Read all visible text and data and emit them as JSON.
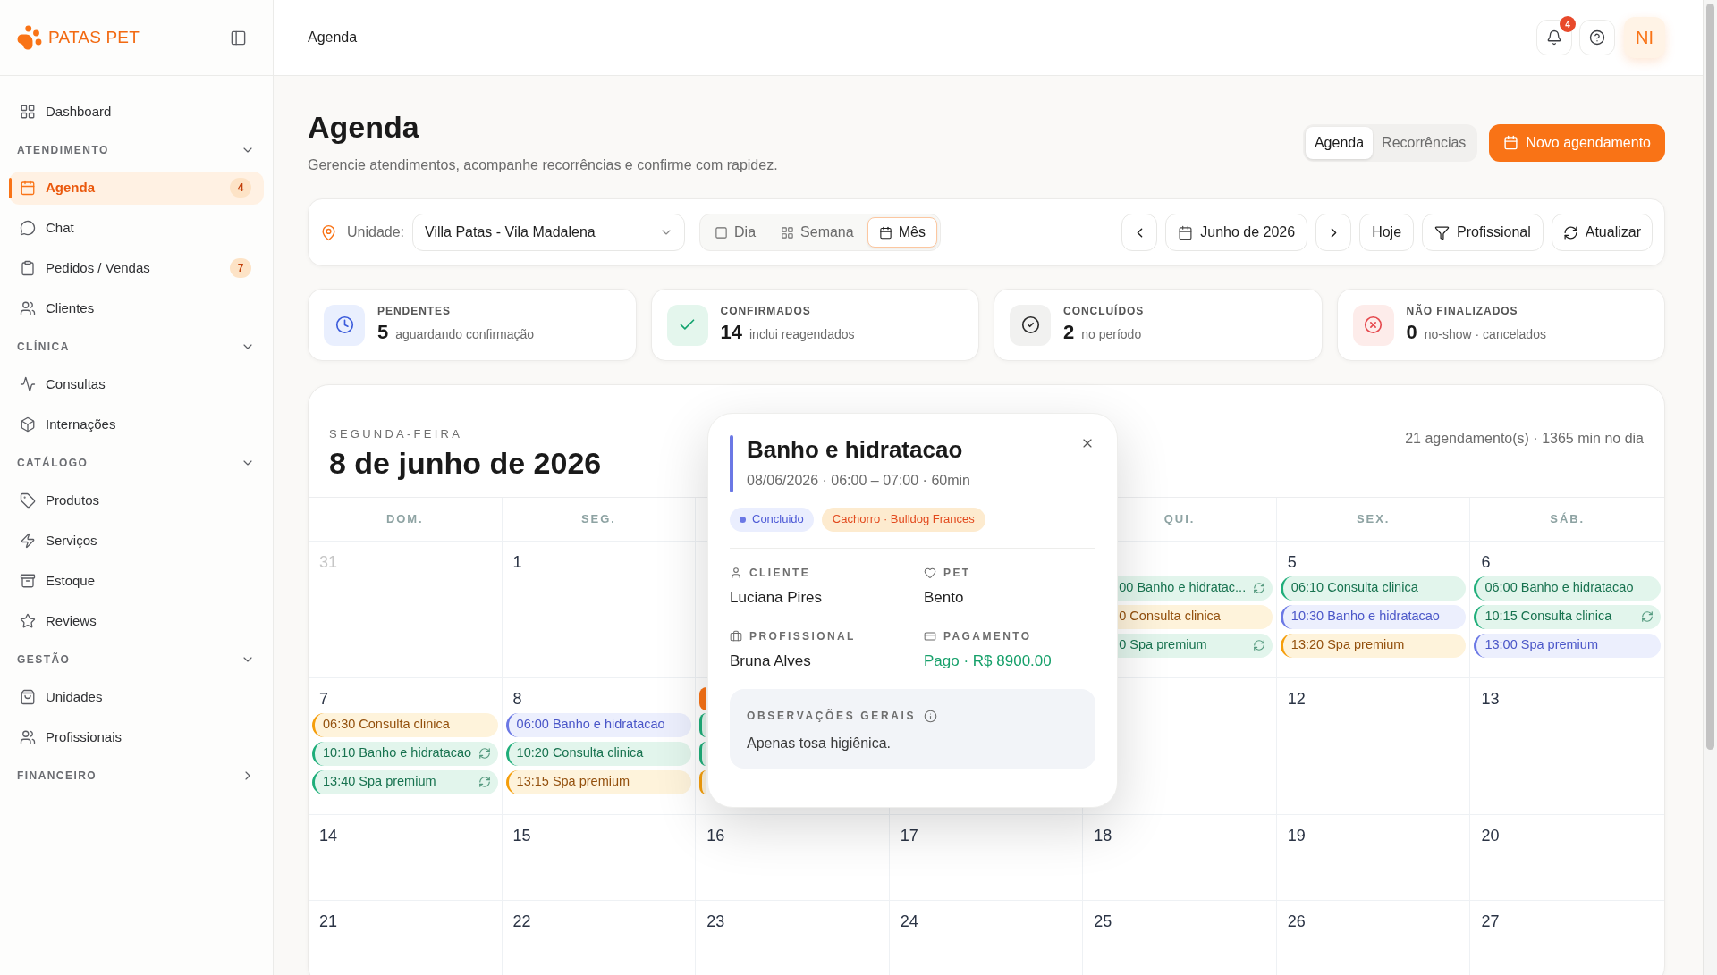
{
  "sidebar": {
    "brand": "PATAS PET",
    "top_items": [
      {
        "label": "Dashboard",
        "selected": false
      }
    ],
    "sections": [
      {
        "title": "ATENDIMENTO",
        "expanded": true,
        "items": [
          {
            "label": "Agenda",
            "selected": true,
            "badge": "4"
          },
          {
            "label": "Chat",
            "selected": false
          },
          {
            "label": "Pedidos / Vendas",
            "selected": false,
            "badge": "7"
          },
          {
            "label": "Clientes",
            "selected": false
          }
        ]
      },
      {
        "title": "CLÍNICA",
        "expanded": true,
        "items": [
          {
            "label": "Consultas",
            "selected": false
          },
          {
            "label": "Internações",
            "selected": false
          }
        ]
      },
      {
        "title": "CATÁLOGO",
        "expanded": true,
        "items": [
          {
            "label": "Produtos",
            "selected": false
          },
          {
            "label": "Serviços",
            "selected": false
          },
          {
            "label": "Estoque",
            "selected": false
          },
          {
            "label": "Reviews",
            "selected": false
          }
        ]
      },
      {
        "title": "GESTÃO",
        "expanded": true,
        "items": [
          {
            "label": "Unidades",
            "selected": false
          },
          {
            "label": "Profissionais",
            "selected": false
          }
        ]
      },
      {
        "title": "FINANCEIRO",
        "expanded": false
      }
    ]
  },
  "topbar": {
    "title": "Agenda",
    "notifications": "4",
    "avatar": "NI"
  },
  "page": {
    "title": "Agenda",
    "subtitle": "Gerencie atendimentos, acompanhe recorrências e confirme com rapidez.",
    "tabs": [
      {
        "label": "Agenda",
        "selected": true
      },
      {
        "label": "Recorrências",
        "selected": false
      }
    ],
    "primary_button": "Novo agendamento"
  },
  "toolbar": {
    "unit_label": "Unidade:",
    "unit_value": "Villa Patas - Vila Madalena",
    "views": [
      {
        "label": "Dia",
        "selected": false
      },
      {
        "label": "Semana",
        "selected": false
      },
      {
        "label": "Mês",
        "selected": true
      }
    ],
    "period": "Junho de 2026",
    "today_button": "Hoje",
    "filter_button": "Profissional",
    "refresh_button": "Atualizar"
  },
  "stats": [
    {
      "kind": "pending",
      "label": "PENDENTES",
      "value": "5",
      "note": "aguardando confirmação"
    },
    {
      "kind": "confirmed",
      "label": "CONFIRMADOS",
      "value": "14",
      "note": "inclui reagendados"
    },
    {
      "kind": "completed",
      "label": "CONCLUÍDOS",
      "value": "2",
      "note": "no período"
    },
    {
      "kind": "unfinished",
      "label": "NÃO FINALIZADOS",
      "value": "0",
      "note": "no-show · cancelados"
    }
  ],
  "calendar": {
    "weekday": "SEGUNDA-FEIRA",
    "date": "8 de junho de 2026",
    "summary": "21 agendamento(s) · 1365 min no dia",
    "weekdays": [
      {
        "kind": "label",
        "label": "DOM."
      },
      {
        "kind": "label",
        "label": "SEG."
      },
      {
        "kind": "covered"
      },
      {
        "kind": "covered"
      },
      {
        "kind": "label",
        "label": "QUI."
      },
      {
        "kind": "label",
        "label": "SEX."
      },
      {
        "kind": "label",
        "label": "SÁB."
      }
    ],
    "weeks": [
      {
        "days": [
          {
            "kind": "day",
            "day": "31",
            "muted": true
          },
          {
            "kind": "day",
            "day": "1",
            "muted": false
          },
          {
            "kind": "covered"
          },
          {
            "kind": "covered"
          },
          {
            "kind": "covered",
            "events": [
              {
                "kind": "cut",
                "text": "00 Banho e hidratac...",
                "color": "#e2f5ec",
                "recurring": true
              },
              {
                "kind": "cut",
                "text": "0 Consulta clinica",
                "color": "#fef3db",
                "recurring": false
              },
              {
                "kind": "cut",
                "text": "0 Spa premium",
                "color": "#e2f5ec",
                "recurring": true
              }
            ]
          },
          {
            "kind": "day",
            "day": "5",
            "muted": false,
            "events": [
              {
                "kind": "full",
                "text": "06:10 Consulta clinica",
                "color": "#1fae7a",
                "recurring": false
              },
              {
                "kind": "full",
                "text": "10:30 Banho e hidratacao",
                "color": "#6b78e5",
                "recurring": false
              },
              {
                "kind": "full",
                "text": "13:20 Spa premium",
                "color": "#f59e0b",
                "recurring": false
              }
            ]
          },
          {
            "kind": "day",
            "day": "6",
            "muted": false,
            "events": [
              {
                "kind": "full",
                "text": "06:00 Banho e hidratacao",
                "color": "#1fae7a",
                "recurring": false
              },
              {
                "kind": "full",
                "text": "10:15 Consulta clinica",
                "color": "#1fae7a",
                "recurring": true
              },
              {
                "kind": "full",
                "text": "13:00 Spa premium",
                "color": "#6b78e5",
                "recurring": false
              }
            ]
          }
        ]
      },
      {
        "days": [
          {
            "kind": "day",
            "day": "7",
            "muted": false,
            "events": [
              {
                "kind": "full",
                "text": "06:30 Consulta clinica",
                "color": "#f59e0b",
                "recurring": false
              },
              {
                "kind": "full",
                "text": "10:10 Banho e hidratacao",
                "color": "#1fae7a",
                "recurring": true
              },
              {
                "kind": "full",
                "text": "13:40 Spa premium",
                "color": "#1fae7a",
                "recurring": true
              }
            ]
          },
          {
            "kind": "day",
            "day": "8",
            "muted": false,
            "events": [
              {
                "kind": "full",
                "text": "06:00 Banho e hidratacao",
                "color": "#6b78e5",
                "recurring": false
              },
              {
                "kind": "full",
                "text": "10:20 Consulta clinica",
                "color": "#1fae7a",
                "recurring": false
              },
              {
                "kind": "full",
                "text": "13:15 Spa premium",
                "color": "#f59e0b",
                "recurring": false
              }
            ]
          },
          {
            "kind": "covered",
            "today": true,
            "events": [
              {
                "kind": "edge",
                "color": "#1fae7a"
              },
              {
                "kind": "edge",
                "color": "#1fae7a"
              },
              {
                "kind": "edge",
                "color": "#f59e0b"
              }
            ]
          },
          {
            "kind": "covered"
          },
          {
            "kind": "covered"
          },
          {
            "kind": "day",
            "day": "12",
            "muted": false
          },
          {
            "kind": "day",
            "day": "13",
            "muted": false
          }
        ]
      },
      {
        "days": [
          {
            "kind": "day",
            "day": "14",
            "muted": false
          },
          {
            "kind": "day",
            "day": "15",
            "muted": false
          },
          {
            "kind": "day",
            "day": "16",
            "muted": false
          },
          {
            "kind": "day",
            "day": "17",
            "muted": false
          },
          {
            "kind": "day",
            "day": "18",
            "muted": false
          },
          {
            "kind": "day",
            "day": "19",
            "muted": false
          },
          {
            "kind": "day",
            "day": "20",
            "muted": false
          }
        ]
      },
      {
        "days": [
          {
            "kind": "day",
            "day": "21",
            "muted": false
          },
          {
            "kind": "day",
            "day": "22",
            "muted": false
          },
          {
            "kind": "day",
            "day": "23",
            "muted": false
          },
          {
            "kind": "day",
            "day": "24",
            "muted": false
          },
          {
            "kind": "day",
            "day": "25",
            "muted": false
          },
          {
            "kind": "day",
            "day": "26",
            "muted": false
          },
          {
            "kind": "day",
            "day": "27",
            "muted": false
          }
        ]
      }
    ]
  },
  "popover": {
    "title": "Banho e hidratacao",
    "meta": "08/06/2026 · 06:00 – 07:00 · 60min",
    "status": {
      "label": "Concluido",
      "color": "#6b78e5"
    },
    "tag": "Cachorro · Bulldog Frances",
    "fields": [
      {
        "kind": "text",
        "label": "CLIENTE",
        "value": "Luciana Pires"
      },
      {
        "kind": "text",
        "label": "PET",
        "value": "Bento"
      },
      {
        "kind": "text",
        "label": "PROFISSIONAL",
        "value": "Bruna Alves"
      },
      {
        "kind": "paid",
        "label": "PAGAMENTO",
        "value": "Pago · R$ 8900.00"
      }
    ],
    "notes_label": "OBSERVAÇÕES GERAIS",
    "notes": "Apenas tosa higiênica."
  }
}
